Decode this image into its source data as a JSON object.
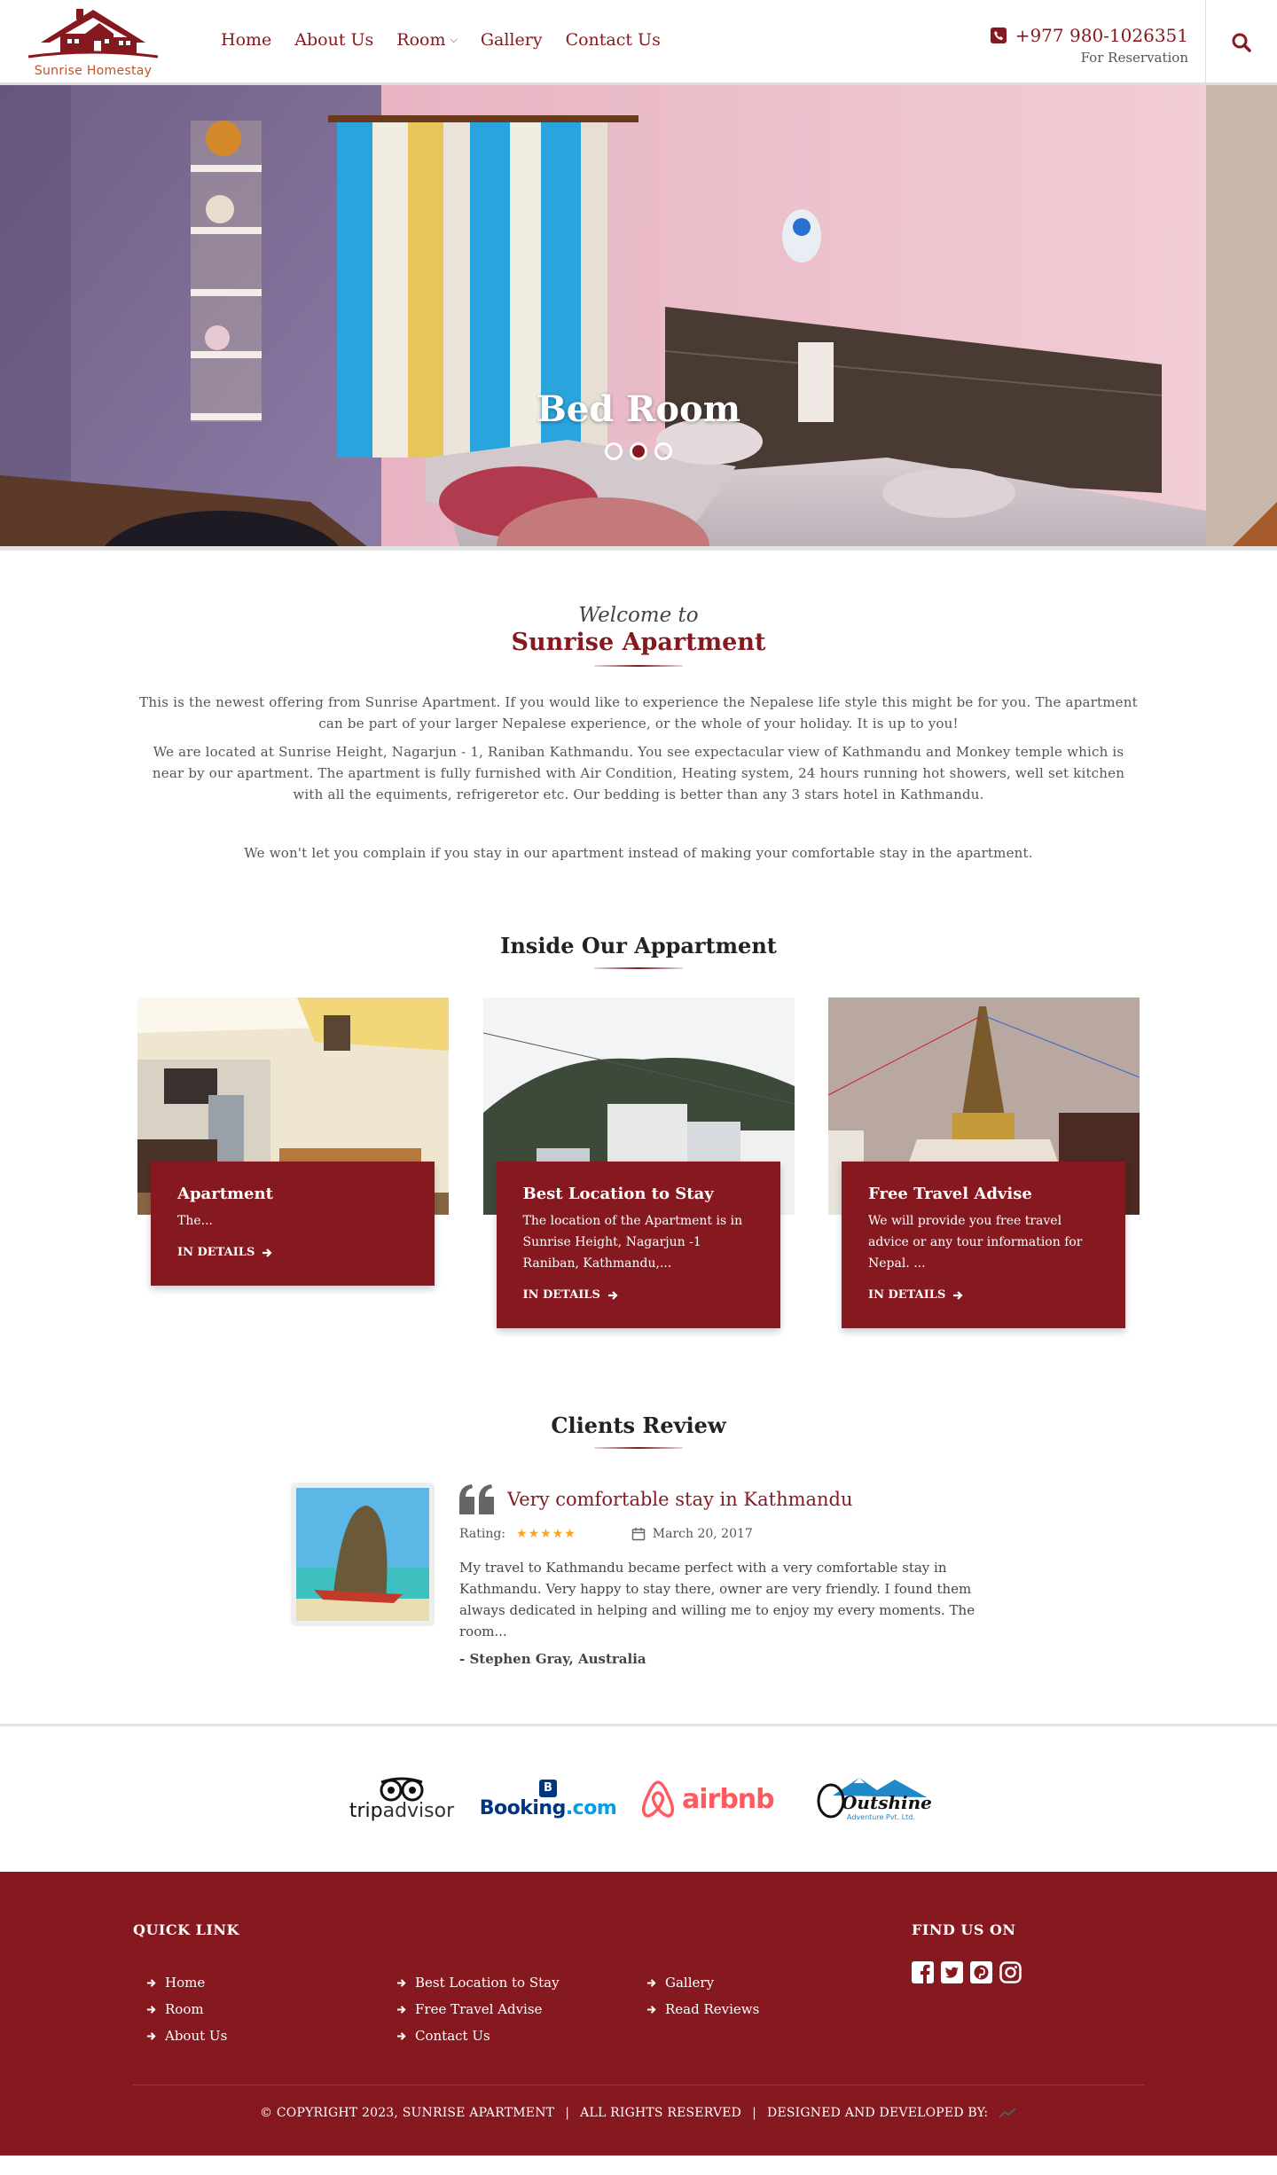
{
  "brand": {
    "name": "Sunrise Homestay",
    "color": "#86181f",
    "accent": "#c0542a"
  },
  "nav": {
    "items": [
      "Home",
      "About Us",
      "Room",
      "Gallery",
      "Contact Us"
    ]
  },
  "contact": {
    "phone": "+977 980-1026351",
    "note": "For Reservation"
  },
  "hero": {
    "caption": "Bed Room",
    "slides": 3,
    "active_slide": 2
  },
  "welcome": {
    "script": "Welcome to",
    "title": "Sunrise Apartment",
    "p1": "This is the newest offering from Sunrise Apartment. If you would like to experience the Nepalese life style this might be for you. The apartment can be part of your larger Nepalese experience, or the whole of your holiday. It is up to you!",
    "p2": "We are located at Sunrise Height, Nagarjun - 1, Raniban Kathmandu.  You see expectacular view of Kathmandu and Monkey temple which is near by our apartment.  The apartment is fully furnished with Air Condition, Heating system, 24 hours running hot showers, well set kitchen with all the equiments, refrigeretor etc.  Our bedding is better than any 3 stars hotel in Kathmandu.",
    "p3": "We won't let you complain if you stay in our apartment instead of making your comfortable stay in the apartment."
  },
  "inside": {
    "title": "Inside Our Appartment",
    "cards": [
      {
        "title": "Apartment",
        "text": "The...",
        "link": "IN DETAILS"
      },
      {
        "title": "Best Location to Stay",
        "text": "The location of the Apartment is in Sunrise Height, Nagarjun -1 Raniban, Kathmandu,...",
        "link": "IN DETAILS"
      },
      {
        "title": "Free Travel Advise",
        "text": "We will provide you free travel advice or any tour information for Nepal. ...",
        "link": "IN DETAILS"
      }
    ]
  },
  "reviews": {
    "title": "Clients Review",
    "item": {
      "headline": "Very comfortable stay in Kathmandu",
      "rating_label": "Rating:",
      "rating": 5,
      "stars": "★★★★★",
      "date": "March 20, 2017",
      "text": "My travel to Kathmandu became perfect with a very comfortable stay in Kathmandu. Very happy to stay there, owner are very friendly. I found them always dedicated in helping and willing me to enjoy my every moments. The room...",
      "author": "- Stephen Gray, Australia"
    }
  },
  "partners": {
    "tripadvisor": {
      "part1": "trip",
      "part2": "advisor"
    },
    "booking": {
      "badge": "B",
      "part1": "Booking",
      "part2": ".com"
    },
    "airbnb": "airbnb",
    "outshine": {
      "name": "Outshine",
      "sub": "Adventure Pvt. Ltd."
    }
  },
  "footer": {
    "quick_link_title": "QUICK LINK",
    "quick_links": [
      [
        "Home",
        "Room",
        "About Us"
      ],
      [
        "Best Location to Stay",
        "Free Travel Advise",
        "Contact Us"
      ],
      [
        "Gallery",
        "Read Reviews"
      ]
    ],
    "find_us_title": "FIND US ON",
    "social_icons": [
      "facebook-icon",
      "twitter-icon",
      "pinterest-icon",
      "instagram-icon"
    ],
    "copyright": "© COPYRIGHT 2023, SUNRISE APARTMENT",
    "rights": "ALL RIGHTS RESERVED",
    "designed": "DESIGNED AND DEVELOPED BY:"
  }
}
